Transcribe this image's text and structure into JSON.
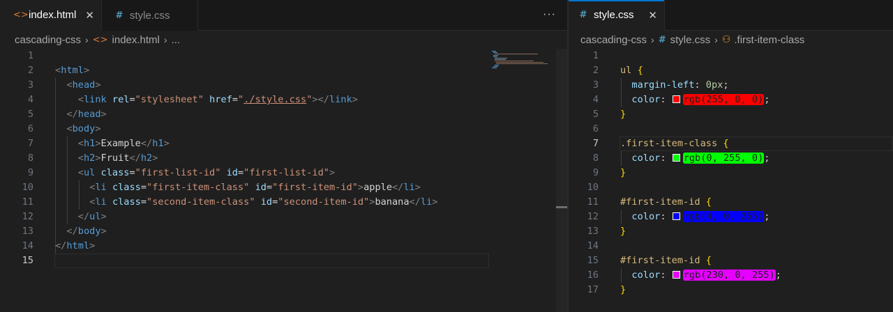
{
  "left_editor": {
    "tabs": [
      {
        "icon": "html-file-icon",
        "label": "index.html",
        "close": "✕"
      },
      {
        "icon": "css-file-icon",
        "label": "style.css"
      }
    ],
    "more_actions": "···",
    "breadcrumbs": [
      "cascading-css",
      "index.html",
      "..."
    ],
    "line_numbers": [
      "1",
      "2",
      "3",
      "4",
      "5",
      "6",
      "7",
      "8",
      "9",
      "10",
      "11",
      "12",
      "13",
      "14",
      "15"
    ],
    "current_line": "15",
    "code": {
      "l2": [
        "<",
        "html",
        ">"
      ],
      "l3": [
        "<",
        "head",
        ">"
      ],
      "l4": [
        "<",
        "link",
        " ",
        "rel",
        "=",
        "\"stylesheet\"",
        " ",
        "href",
        "=",
        "\"",
        "./style.css",
        "\"",
        "></",
        "link",
        ">"
      ],
      "l5": [
        "</",
        "head",
        ">"
      ],
      "l6": [
        "<",
        "body",
        ">"
      ],
      "l7": [
        "<",
        "h1",
        ">",
        "Example",
        "</",
        "h1",
        ">"
      ],
      "l8": [
        "<",
        "h2",
        ">",
        "Fruit",
        "</",
        "h2",
        ">"
      ],
      "l9": [
        "<",
        "ul",
        " ",
        "class",
        "=",
        "\"first-list-id\"",
        " ",
        "id",
        "=",
        "\"first-list-id\"",
        ">"
      ],
      "l10": [
        "<",
        "li",
        " ",
        "class",
        "=",
        "\"first-item-class\"",
        " ",
        "id",
        "=",
        "\"first-item-id\"",
        ">",
        "apple",
        "</",
        "li",
        ">"
      ],
      "l11": [
        "<",
        "li",
        " ",
        "class",
        "=",
        "\"second-item-class\"",
        " ",
        "id",
        "=",
        "\"second-item-id\"",
        ">",
        "banana",
        "</",
        "li",
        ">"
      ],
      "l12": [
        "</",
        "ul",
        ">"
      ],
      "l13": [
        "</",
        "body",
        ">"
      ],
      "l14": [
        "</",
        "html",
        ">"
      ]
    }
  },
  "right_editor": {
    "tab": {
      "icon": "css-file-icon",
      "label": "style.css",
      "close": "✕"
    },
    "breadcrumbs": [
      "cascading-css",
      "style.css",
      ".first-item-class"
    ],
    "line_numbers": [
      "1",
      "2",
      "3",
      "4",
      "5",
      "6",
      "7",
      "8",
      "9",
      "10",
      "11",
      "12",
      "13",
      "14",
      "15",
      "16",
      "17"
    ],
    "current_line": "7",
    "code": {
      "l2": [
        "ul",
        " ",
        "{"
      ],
      "l3": [
        "margin-left",
        ": ",
        "0px",
        ";"
      ],
      "l4": [
        "color",
        ": ",
        "rgb(255, 0, 0)",
        ";"
      ],
      "l5": [
        "}"
      ],
      "l7": [
        ".first-item-class",
        " ",
        "{"
      ],
      "l8": [
        "color",
        ": ",
        "rgb(0, 255, 0)",
        ";"
      ],
      "l9": [
        "}"
      ],
      "l11": [
        "#first-item-id",
        " ",
        "{"
      ],
      "l12": [
        "color",
        ": ",
        "rgb(4, 0, 255)",
        ";"
      ],
      "l13": [
        "}"
      ],
      "l15": [
        "#first-item-id",
        " ",
        "{"
      ],
      "l16": [
        "color",
        ": ",
        "rgb(230, 0, 255)",
        ";"
      ],
      "l17": [
        "}"
      ]
    },
    "colors": {
      "red": "#ff0000",
      "green": "#00ff00",
      "blue": "#0400ff",
      "magenta": "#e600ff"
    }
  }
}
